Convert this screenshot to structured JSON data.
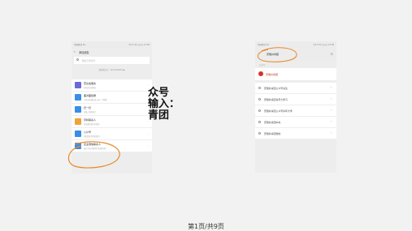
{
  "left_phone": {
    "status_left": "中国移动 4G",
    "status_right": "下午5:32 ◎◎◎ 13:08",
    "nav_title": "添加朋友",
    "search_placeholder": "微信号/手机号",
    "my_account": "我的微信号：bhanwei000 ▣",
    "items": [
      {
        "title": "雷达加朋友",
        "subtitle": "添加身边的朋友",
        "color": "#6b6bd6"
      },
      {
        "title": "面对面建群",
        "subtitle": "与身边的朋友进入同一个群聊",
        "color": "#3a8ee6"
      },
      {
        "title": "扫一扫",
        "subtitle": "扫描二维码名片",
        "color": "#3a8ee6"
      },
      {
        "title": "手机联系人",
        "subtitle": "添加通讯录中的朋友",
        "color": "#f0a33a"
      },
      {
        "title": "公众号",
        "subtitle": "获取更多资讯和服务",
        "color": "#3a8ee6"
      },
      {
        "title": "企业微信联系人",
        "subtitle": "通过手机号搜索企业微信用户",
        "color": "#3a8ee6"
      }
    ]
  },
  "right_phone": {
    "status_left": "中国移动 4G",
    "status_right": "下午5:32 ◎◎◎ 13:08",
    "search_query": "安徽共青团",
    "sub_label": "公众号",
    "account_name": "安徽共青团",
    "suggestions": [
      "安徽共青团公众号关注",
      "安徽共青团青年大学习",
      "安徽共青团公众号青年大学",
      "安徽共青团中央",
      "安徽共青团微信"
    ]
  },
  "overlay": {
    "line1": "众号",
    "line2": "输入：",
    "line3": "青团"
  },
  "footer": {
    "page_label": "第1页/共9页"
  },
  "colors": {
    "annotation": "#e8892a",
    "account_red": "#d9302c"
  }
}
